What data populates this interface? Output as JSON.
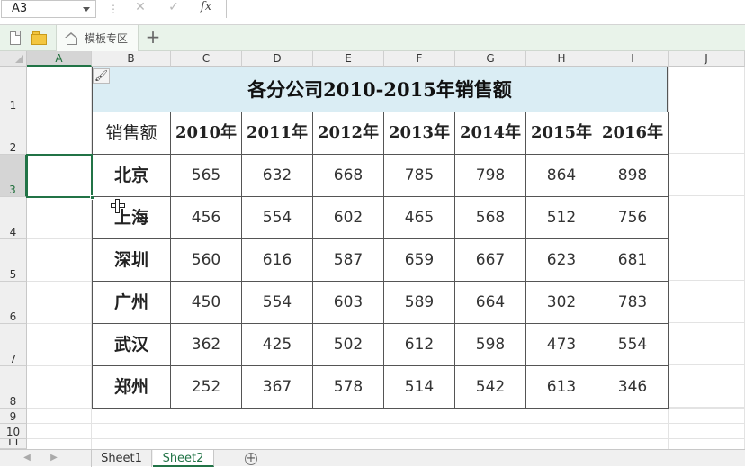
{
  "formula_bar": {
    "name_box": "A3",
    "cancel_glyph": "✕",
    "confirm_glyph": "✓",
    "fx_label": "fx",
    "formula_value": ""
  },
  "tab_strip": {
    "template_tab_label": "模板专区",
    "new_tab_glyph": "+"
  },
  "grid": {
    "active_cell": "A3",
    "columns": [
      "A",
      "B",
      "C",
      "D",
      "E",
      "F",
      "G",
      "H",
      "I",
      "J"
    ],
    "rows": [
      "1",
      "2",
      "3",
      "4",
      "5",
      "6",
      "7",
      "8",
      "9",
      "10",
      "11"
    ]
  },
  "table": {
    "title": "各分公司2010-2015年销售额",
    "header_label": "销售额",
    "years": [
      "2010年",
      "2011年",
      "2012年",
      "2013年",
      "2014年",
      "2015年",
      "2016年"
    ],
    "rows": [
      {
        "city": "北京",
        "values": [
          "565",
          "632",
          "668",
          "785",
          "798",
          "864",
          "898"
        ]
      },
      {
        "city": "上海",
        "values": [
          "456",
          "554",
          "602",
          "465",
          "568",
          "512",
          "756"
        ]
      },
      {
        "city": "深圳",
        "values": [
          "560",
          "616",
          "587",
          "659",
          "667",
          "623",
          "681"
        ]
      },
      {
        "city": "广州",
        "values": [
          "450",
          "554",
          "603",
          "589",
          "664",
          "302",
          "783"
        ]
      },
      {
        "city": "武汉",
        "values": [
          "362",
          "425",
          "502",
          "612",
          "598",
          "473",
          "554"
        ]
      },
      {
        "city": "郑州",
        "values": [
          "252",
          "367",
          "578",
          "514",
          "542",
          "613",
          "346"
        ]
      }
    ]
  },
  "sheets": {
    "tabs": [
      "Sheet1",
      "Sheet2"
    ],
    "active": "Sheet2",
    "add_glyph": "+"
  },
  "colors": {
    "accent": "#217346",
    "title_fill": "#daedf4",
    "tab_strip": "#e9f3ea"
  }
}
